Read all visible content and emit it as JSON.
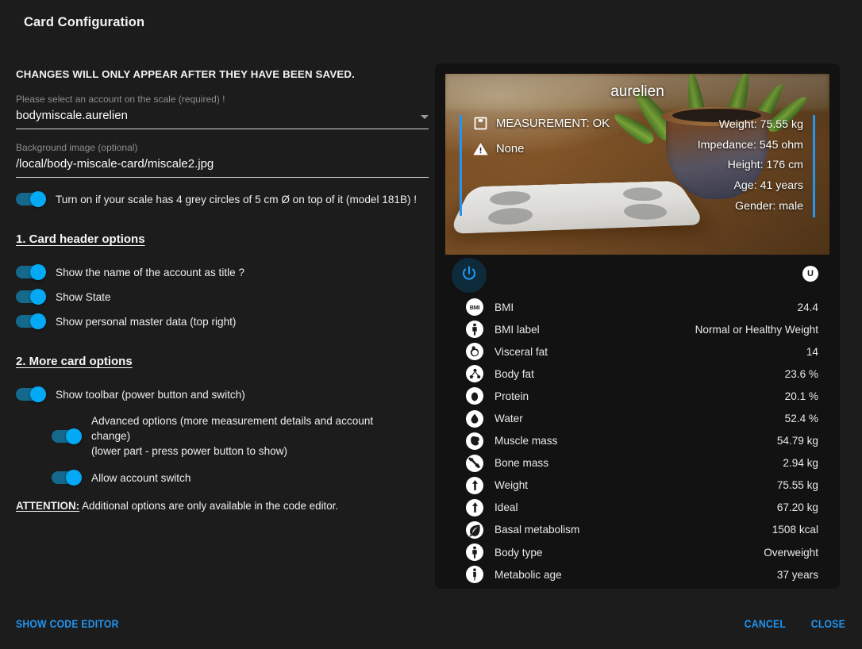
{
  "dialog": {
    "title": "Card Configuration",
    "warning": "CHANGES WILL ONLY APPEAR AFTER THEY HAVE BEEN SAVED."
  },
  "fields": {
    "account": {
      "label": "Please select an account on the scale (required) !",
      "value": "bodymiscale.aurelien",
      "icon": "chevron-down-icon"
    },
    "background_image": {
      "label": "Background image (optional)",
      "value": "/local/body-miscale-card/miscale2.jpg"
    }
  },
  "options": {
    "grey_circles": {
      "label": "Turn on if your scale has 4 grey circles of 5 cm Ø on top of it (model 181B) !",
      "on": true
    },
    "section_header": "1. Card header options",
    "show_name": {
      "label": "Show the name of the account as title ?",
      "on": true
    },
    "show_state": {
      "label": "Show State",
      "on": true
    },
    "show_master_data": {
      "label": "Show personal master data (top right)",
      "on": true
    },
    "section_more": "2. More card options",
    "show_toolbar": {
      "label": "Show toolbar (power button and switch)",
      "on": true
    },
    "advanced": {
      "label": "Advanced options (more measurement details and account change)",
      "sub_label": "(lower part - press power button to show)",
      "on": true
    },
    "allow_switch": {
      "label": "Allow account switch",
      "on": true
    },
    "attention_bold": "ATTENTION:",
    "attention_text": " Additional options are only available in the code editor."
  },
  "preview": {
    "title": "aurelien",
    "state": {
      "measurement": {
        "icon": "scale-icon",
        "text": "MEASUREMENT: OK"
      },
      "problem": {
        "icon": "warning-icon",
        "text": "None"
      }
    },
    "master_data": [
      "Weight: 75.55 kg",
      "Impedance: 545 ohm",
      "Height: 176 cm",
      "Age: 41 years",
      "Gender: male"
    ],
    "toolbar": {
      "power_icon": "power-icon",
      "user_badge": "U"
    },
    "rows": [
      {
        "icon": "bmi-icon",
        "label": "BMI",
        "value": "24.4"
      },
      {
        "icon": "person-icon",
        "label": "BMI label",
        "value": "Normal or Healthy Weight"
      },
      {
        "icon": "stomach-icon",
        "label": "Visceral fat",
        "value": "14"
      },
      {
        "icon": "molecule-icon",
        "label": "Body fat",
        "value": "23.6 %"
      },
      {
        "icon": "egg-icon",
        "label": "Protein",
        "value": "20.1 %"
      },
      {
        "icon": "water-drop-icon",
        "label": "Water",
        "value": "52.4 %"
      },
      {
        "icon": "muscle-icon",
        "label": "Muscle mass",
        "value": "54.79 kg"
      },
      {
        "icon": "bone-icon",
        "label": "Bone mass",
        "value": "2.94 kg"
      },
      {
        "icon": "weight-icon",
        "label": "Weight",
        "value": "75.55 kg"
      },
      {
        "icon": "ideal-icon",
        "label": "Ideal",
        "value": "67.20 kg"
      },
      {
        "icon": "leaf-icon",
        "label": "Basal metabolism",
        "value": "1508 kcal"
      },
      {
        "icon": "body-type-icon",
        "label": "Body type",
        "value": "Overweight"
      },
      {
        "icon": "metabolic-icon",
        "label": "Metabolic age",
        "value": "37 years"
      }
    ]
  },
  "footer": {
    "code_editor": "SHOW CODE EDITOR",
    "cancel": "CANCEL",
    "close": "CLOSE"
  },
  "colors": {
    "accent_blue": "#2196f3",
    "toggle_knob": "#03a9f4",
    "toggle_track": "#14698d",
    "page_bg": "#1c1c1c",
    "card_bg": "#121212"
  }
}
